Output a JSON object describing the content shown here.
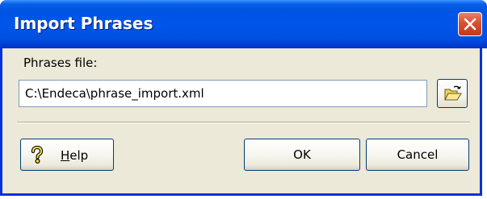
{
  "window": {
    "title": "Import Phrases"
  },
  "form": {
    "file_label": "Phrases file:",
    "file_value": "C:\\Endeca\\phrase_import.xml"
  },
  "buttons": {
    "help_mnemonic": "H",
    "help_rest": "elp",
    "ok": "OK",
    "cancel": "Cancel"
  },
  "icons": {
    "close": "close-icon",
    "browse": "open-folder-icon",
    "help": "question-mark-icon"
  },
  "colors": {
    "titlebar": "#0054e3",
    "dialog_bg": "#ece9d8",
    "close_button": "#d8502f",
    "button_border": "#003c74",
    "field_border": "#7f9db9"
  }
}
